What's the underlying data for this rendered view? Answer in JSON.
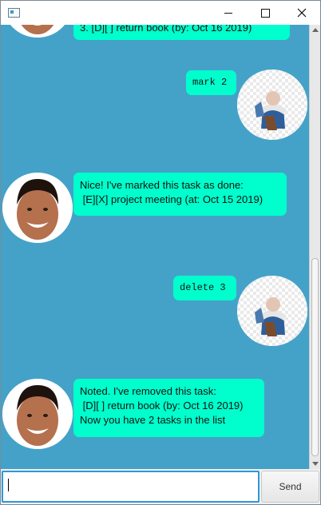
{
  "window": {
    "title": ""
  },
  "chat": {
    "messages": [
      {
        "sender": "bot",
        "lines": [
          "3. [D][ ] return book (by: Oct 16 2019)"
        ]
      },
      {
        "sender": "user",
        "lines": [
          "mark 2"
        ]
      },
      {
        "sender": "bot",
        "lines": [
          "Nice! I've marked this task as done:",
          " [E][X] project meeting (at: Oct 15 2019)"
        ]
      },
      {
        "sender": "user",
        "lines": [
          "delete 3"
        ]
      },
      {
        "sender": "bot",
        "lines": [
          "Noted. I've removed this task:",
          " [D][ ] return book (by: Oct 16 2019)",
          "Now you have 2 tasks in the list"
        ]
      }
    ]
  },
  "input": {
    "value": "",
    "placeholder": ""
  },
  "send_button": {
    "label": "Send"
  },
  "colors": {
    "chat_background": "#44a2c8",
    "bubble": "#00ffcc",
    "input_focus_border": "#2f97d6"
  },
  "icons": {
    "app": "window-app-icon",
    "minimize": "minimize-icon",
    "maximize": "maximize-icon",
    "close": "close-icon"
  }
}
